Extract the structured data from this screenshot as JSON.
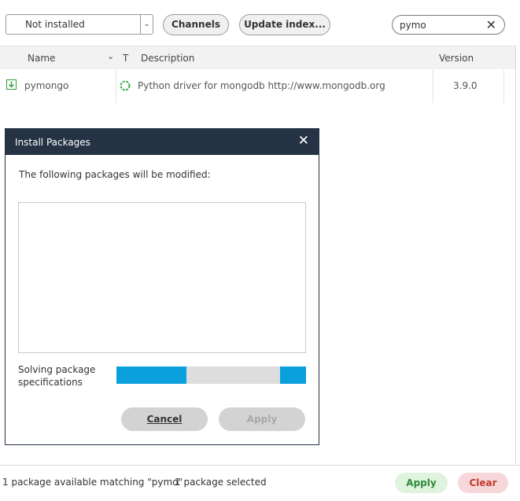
{
  "toolbar": {
    "filter_value": "Not installed",
    "channels_label": "Channels",
    "update_index_label": "Update index...",
    "search_value": "pymo"
  },
  "table": {
    "columns": [
      "Name",
      "T",
      "Description",
      "Version"
    ],
    "rows": [
      {
        "name": "pymongo",
        "description": "Python driver for mongodb http://www.mongodb.org",
        "version": "3.9.0"
      }
    ]
  },
  "dialog": {
    "title": "Install Packages",
    "message": "The following packages will be modified:",
    "status": "Solving package specifications",
    "cancel_label": "Cancel",
    "apply_label": "Apply"
  },
  "footer": {
    "status_text": "1 package available matching \"pymo\"",
    "selected_text": "1 package selected",
    "apply_label": "Apply",
    "clear_label": "Clear"
  },
  "colors": {
    "dialog_title_bg": "#253345",
    "progress": "#0aa0dd",
    "apply_bg": "#dff3df",
    "apply_text": "#2e8b3a",
    "clear_bg": "#f7d7d9",
    "clear_text": "#c0392b",
    "install_icon": "#2e9e3a"
  }
}
